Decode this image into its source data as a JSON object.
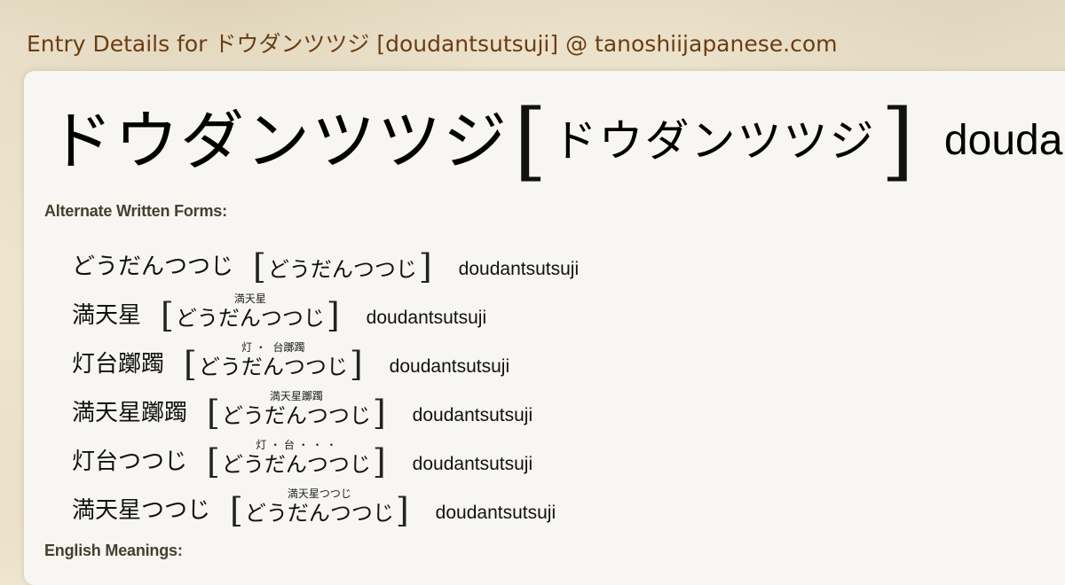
{
  "site": {
    "title": "Entry Details for ドウダンツツジ [doudantsutsuji] @ tanoshiijapanese.com"
  },
  "entry": {
    "headword": "ドウダンツツジ",
    "reading": "ドウダンツツジ",
    "romaji": "doudantsutsuji",
    "bracket_open": "[",
    "bracket_close": "]"
  },
  "sections": {
    "alternate_forms_label": "Alternate Written Forms:",
    "english_meanings_label": "English Meanings:"
  },
  "alternate_forms": [
    {
      "written": "どうだんつつじ",
      "furigana": "",
      "reading": "どうだんつつじ",
      "romaji": "doudantsutsuji"
    },
    {
      "written": "満天星",
      "furigana": "満天星",
      "reading": "どうだんつつじ",
      "romaji": "doudantsutsuji"
    },
    {
      "written": "灯台躑躅",
      "furigana": "灯 ・  台躑躅",
      "reading": "どうだんつつじ",
      "romaji": "doudantsutsuji"
    },
    {
      "written": "満天星躑躅",
      "furigana": "満天星躑躅",
      "reading": "どうだんつつじ",
      "romaji": "doudantsutsuji"
    },
    {
      "written": "灯台つつじ",
      "furigana": "灯 ・ 台 ・ ・ ・",
      "reading": "どうだんつつじ",
      "romaji": "doudantsutsuji"
    },
    {
      "written": "満天星つつじ",
      "furigana": "満天星つつじ",
      "reading": "どうだんつつじ",
      "romaji": "doudantsutsuji"
    }
  ]
}
